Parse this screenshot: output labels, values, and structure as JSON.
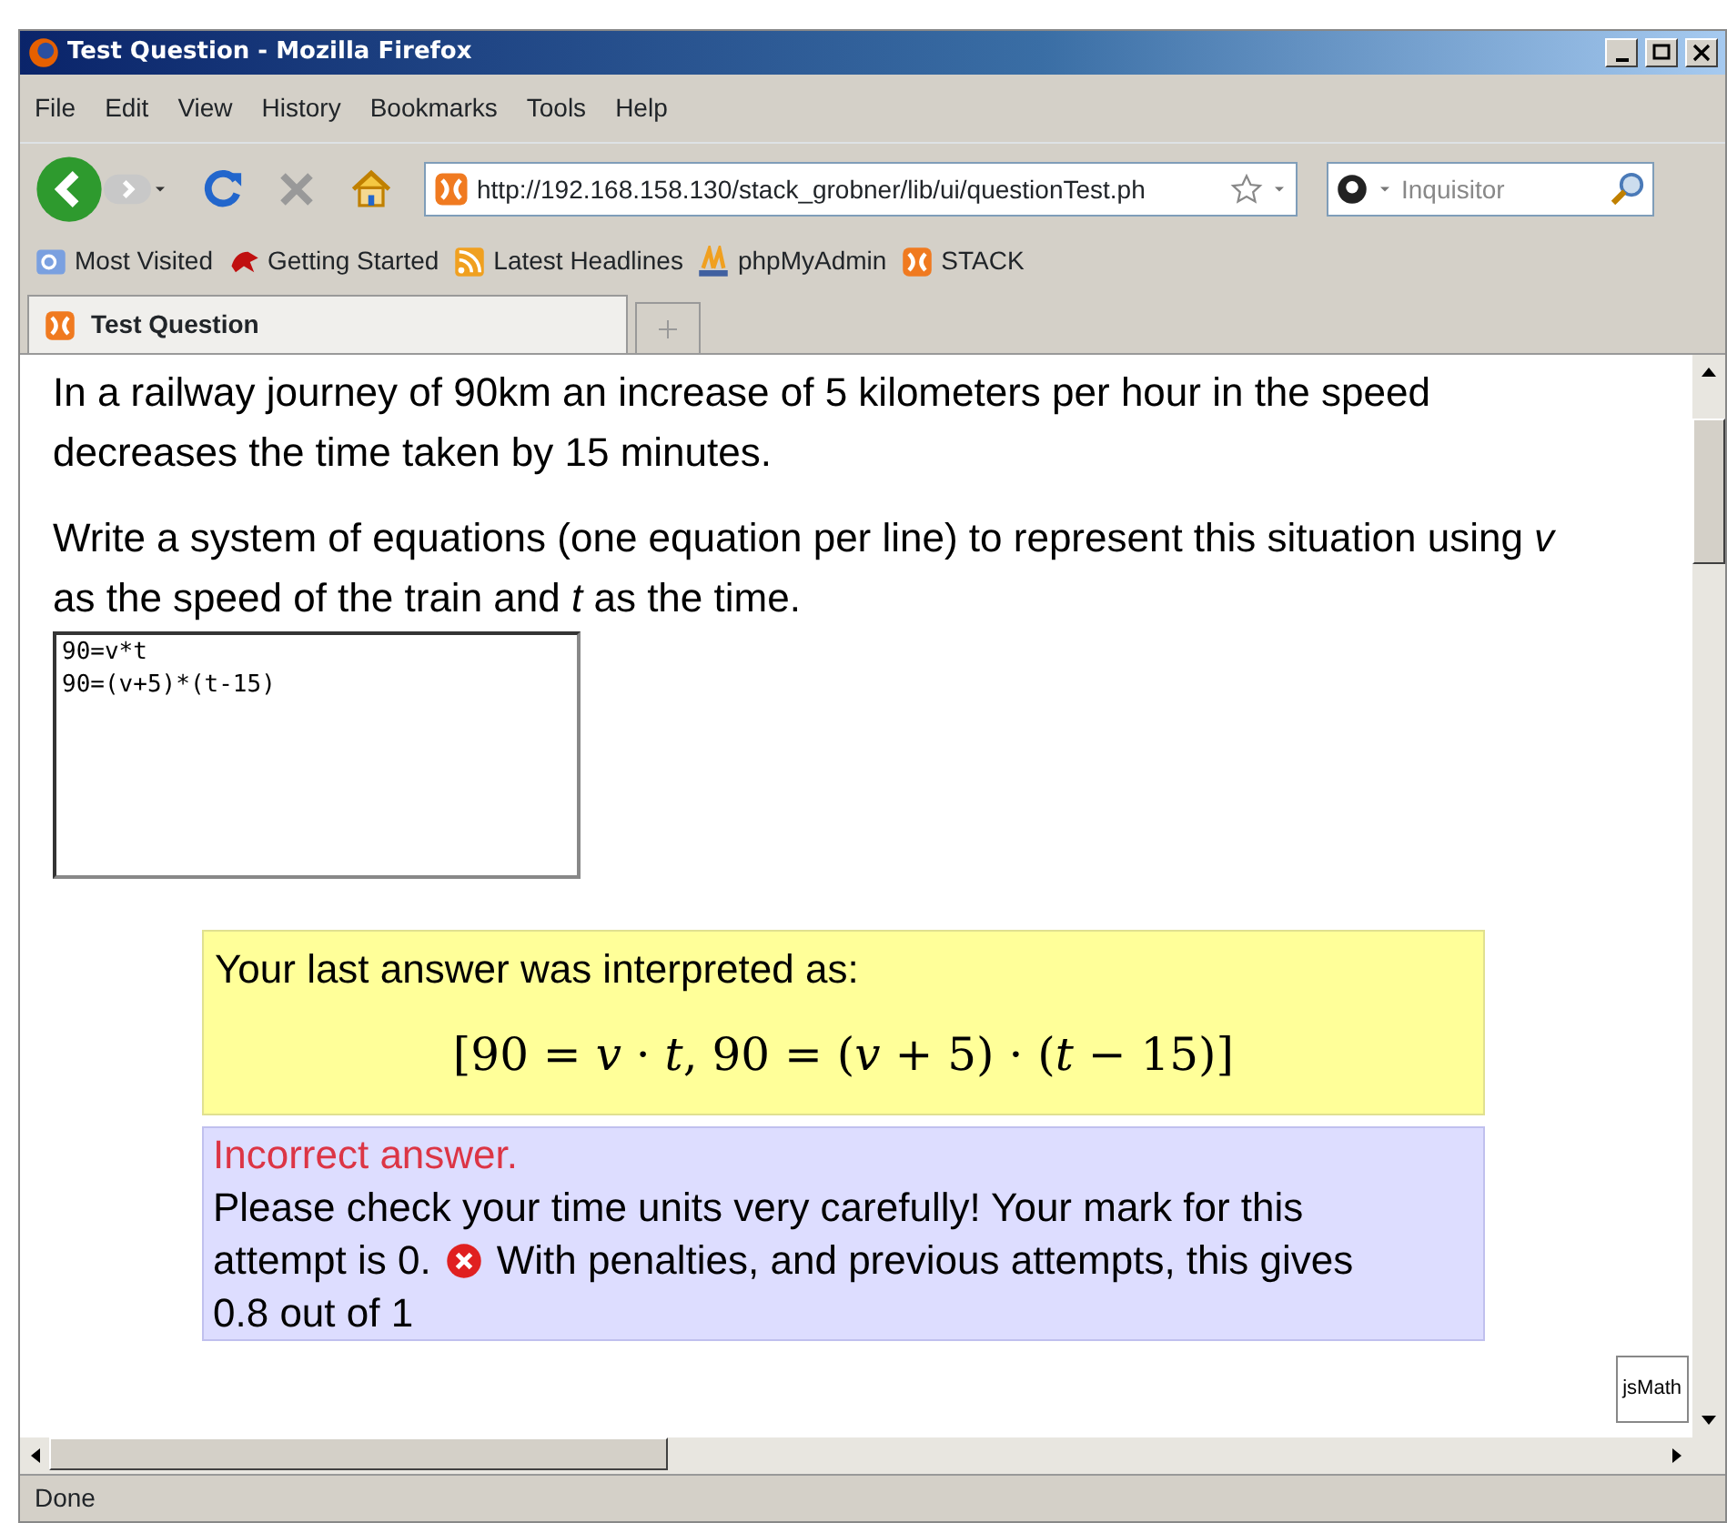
{
  "window": {
    "title": "Test Question - Mozilla Firefox"
  },
  "menu": [
    "File",
    "Edit",
    "View",
    "History",
    "Bookmarks",
    "Tools",
    "Help"
  ],
  "toolbar": {
    "url": "http://192.168.158.130/stack_grobner/lib/ui/questionTest.ph",
    "search": {
      "placeholder": "Inquisitor"
    }
  },
  "bookmarks": [
    {
      "label": "Most Visited",
      "kind": "folder"
    },
    {
      "label": "Getting Started",
      "kind": "bird"
    },
    {
      "label": "Latest Headlines",
      "kind": "feed"
    },
    {
      "label": "phpMyAdmin",
      "kind": "pma"
    },
    {
      "label": "STACK",
      "kind": "stack"
    }
  ],
  "tabs": [
    {
      "label": "Test Question",
      "selected": true
    }
  ],
  "question": {
    "paragraphs": [
      "In a railway journey of 90km an increase of 5 kilometers per hour in the speed decreases the time taken by 15 minutes.",
      "Write a system of equations (one equation per line) to represent this situation using *v* as the speed of the train and *t* as the time."
    ],
    "answer": "90=v*t\n90=(v+5)*(t-15)"
  },
  "interpreted": {
    "label": "Your last answer was interpreted as:",
    "formula": "[90 = *v* · *t*, 90 = (*v* + 5) · (*t* − 15)]"
  },
  "feedback": {
    "verdict": "Incorrect answer.",
    "message": [
      "Please check your time units very carefully! Your mark for this",
      "attempt is 0."
    ],
    "summary": [
      "With penalties, and previous attempts, this gives",
      "0.8 out of 1"
    ]
  },
  "jsmath": "jsMath",
  "status_bar": "Done"
}
